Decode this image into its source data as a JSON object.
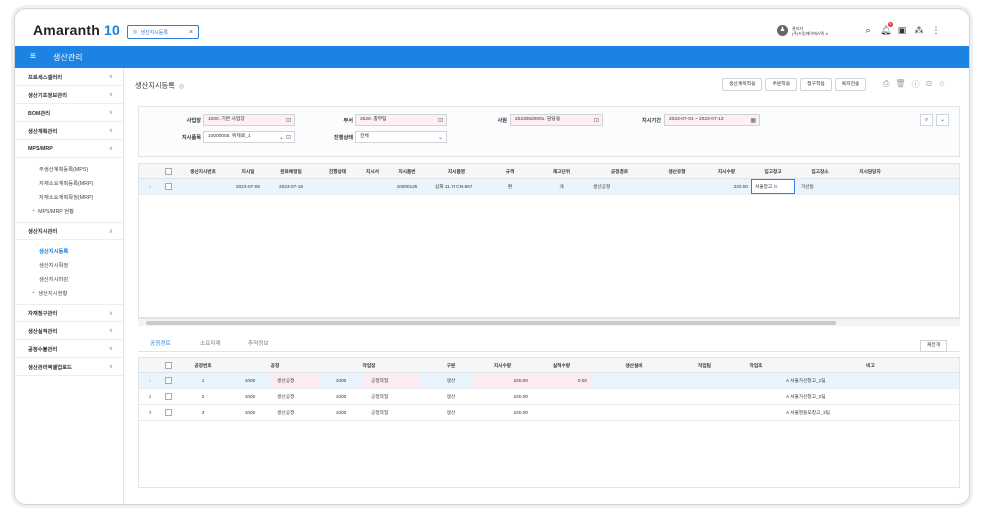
{
  "app": {
    "logo_main": "Amaranth",
    "logo_num": "10",
    "tab_label": "생산지시등록",
    "tab_close": "×"
  },
  "user": {
    "avatar": "♟",
    "name": "관리자",
    "company": "(주)드림에이에스텍 ∨"
  },
  "topicons": [
    "search-icon",
    "bell-icon",
    "calendar-icon",
    "org-icon",
    "more-icon"
  ],
  "menu": {
    "title": "생산관리"
  },
  "sidebar": {
    "items": [
      {
        "label": "프로세스갤러리",
        "chev": "∨"
      },
      {
        "label": "생산기초정보관리",
        "chev": "∨"
      },
      {
        "label": "BOM관리",
        "chev": "∨"
      },
      {
        "label": "생산계획관리",
        "chev": "∨"
      },
      {
        "label": "MPS/MRP",
        "chev": "∧"
      }
    ],
    "mps_subs": [
      "주생산계획등록(MPS)",
      "자재소요계획등록(MRP)",
      "자재소요계획확정(MRP)",
      "MPS/MRP 현황"
    ],
    "order_group": {
      "label": "생산지시관리",
      "chev": "∧"
    },
    "order_subs": [
      "생산지시등록",
      "생산지시확정",
      "생산지시마감",
      "생산지시현황"
    ],
    "more_items": [
      {
        "label": "자재청구관리",
        "chev": "∨"
      },
      {
        "label": "생산실적관리",
        "chev": "∨"
      },
      {
        "label": "공정수불관리",
        "chev": "∨"
      },
      {
        "label": "생산관리엑셀업로드",
        "chev": "∨"
      }
    ]
  },
  "page": {
    "title": "생산지시등록",
    "title_icon": "◎"
  },
  "actions": [
    "생산계획적용",
    "주문적용",
    "청구적용",
    "복지전송"
  ],
  "filters": {
    "site_label": "사업장",
    "site_value": "1000. 기본 사업장",
    "dept_label": "부서",
    "dept_value": "2520. 총무팀",
    "emp_label": "사원",
    "emp_value": "20230620001. 담당용",
    "period_label": "지시기간",
    "period_value": "2023-07-01 ~ 2023-07-13",
    "item_label": "지시품목",
    "item_value": "10000005. 위제로_1",
    "status_label": "진행상태",
    "status_value": "전체"
  },
  "grid1": {
    "headers": [
      "생산지시번호",
      "지시일",
      "완료예정일",
      "진행상태",
      "지시서",
      "지시품번",
      "지시품명",
      "규격",
      "재고단위",
      "공정경로",
      "생산유형",
      "지시수량",
      "입고창고",
      "입고장소",
      "지시담당자"
    ],
    "rows": [
      {
        "cells": [
          "",
          "2023-07-05",
          "2023-07-19",
          "",
          "",
          "10000125",
          "삼화 11.7t CN-657",
          "편",
          "개",
          "생산공정",
          "",
          "220.00",
          "서울창고",
          "가산동",
          ""
        ]
      }
    ]
  },
  "tabs2": {
    "items": [
      "공정경로",
      "소요자재",
      "추적정보"
    ],
    "active": 0,
    "button": "재전개"
  },
  "grid2": {
    "headers": [
      "공정번호",
      "공정",
      "작업장",
      "구분",
      "지시수량",
      "실적수량",
      "생산설비",
      "작업팀",
      "작업조",
      "비고"
    ],
    "rows": [
      {
        "idx": "",
        "cells": [
          "1",
          "1000",
          "생산공정",
          "1000",
          "공정작업",
          "생산",
          "220.00",
          "0.00",
          "",
          "",
          "",
          "A 서울가산창고_1팀"
        ]
      },
      {
        "idx": "2",
        "cells": [
          "2",
          "1000",
          "생산공정",
          "1000",
          "공정작업",
          "생산",
          "220.00",
          "",
          "",
          "",
          "",
          "A 서울가산창고_2팀"
        ]
      },
      {
        "idx": "3",
        "cells": [
          "3",
          "1000",
          "생산공정",
          "1000",
          "공정작업",
          "생산",
          "220.00",
          "",
          "",
          "",
          "",
          "A 서울영등포창고_3팀"
        ]
      }
    ]
  }
}
